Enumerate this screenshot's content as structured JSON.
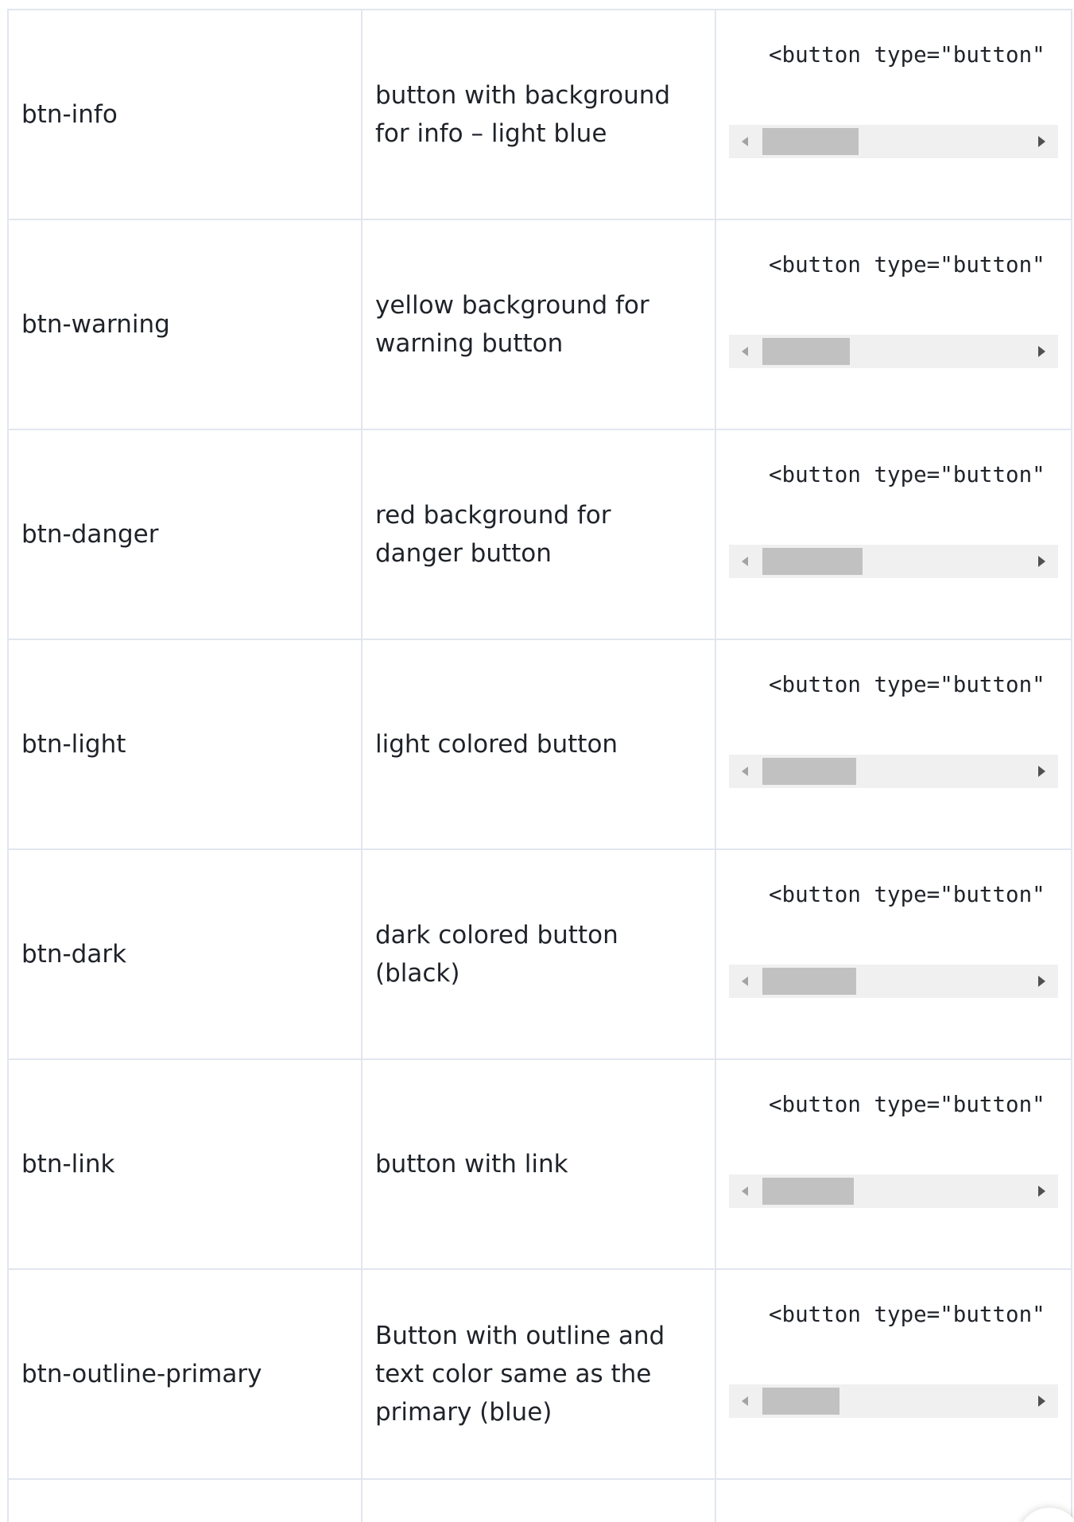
{
  "table": {
    "rows": [
      {
        "class_name": "btn-info",
        "description": "button with background for info – light blue",
        "code": "<button type=\"button\""
      },
      {
        "class_name": "btn-warning",
        "description": "yellow background for warning button",
        "code": "<button type=\"button\""
      },
      {
        "class_name": "btn-danger",
        "description": "red background for danger button",
        "code": "<button type=\"button\""
      },
      {
        "class_name": "btn-light",
        "description": "light colored button",
        "code": "<button type=\"button\""
      },
      {
        "class_name": "btn-dark",
        "description": "dark colored button (black)",
        "code": "<button type=\"button\""
      },
      {
        "class_name": "btn-link",
        "description": "button with link",
        "code": "<button type=\"button\""
      },
      {
        "class_name": "btn-outline-primary",
        "description": "Button with outline and text color same as the primary (blue)",
        "code": "<button type=\"button\""
      }
    ]
  },
  "colors": {
    "border": "#e1e6ee",
    "scrollbar_track": "#f0f0f0",
    "scrollbar_thumb": "#c1c1c1",
    "text": "#1f2329"
  }
}
